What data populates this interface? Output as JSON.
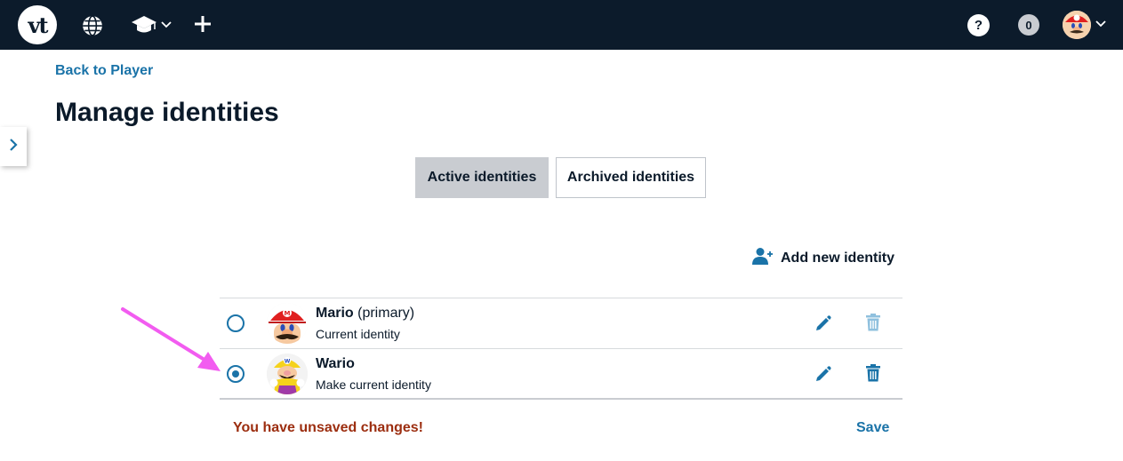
{
  "header": {
    "logo_text": "vt",
    "notification_count": "0",
    "help_label": "?"
  },
  "nav": {
    "back_link": "Back to Player"
  },
  "page": {
    "title": "Manage identities"
  },
  "tabs": [
    {
      "label": "Active identities",
      "active": true
    },
    {
      "label": "Archived identities",
      "active": false
    }
  ],
  "actions": {
    "add_identity": "Add new identity"
  },
  "identities": [
    {
      "name": "Mario",
      "tag": "(primary)",
      "status": "Current identity",
      "selected": false,
      "delete_enabled": false
    },
    {
      "name": "Wario",
      "tag": "",
      "status": "Make current identity",
      "selected": true,
      "delete_enabled": true
    }
  ],
  "footer": {
    "unsaved_message": "You have unsaved changes!",
    "save_label": "Save"
  },
  "colors": {
    "topbar": "#0c1b2b",
    "link": "#1a73a8",
    "warning": "#9c2e10",
    "tab_active_bg": "#c9ccd1",
    "annotation_arrow": "#f25cf0"
  }
}
